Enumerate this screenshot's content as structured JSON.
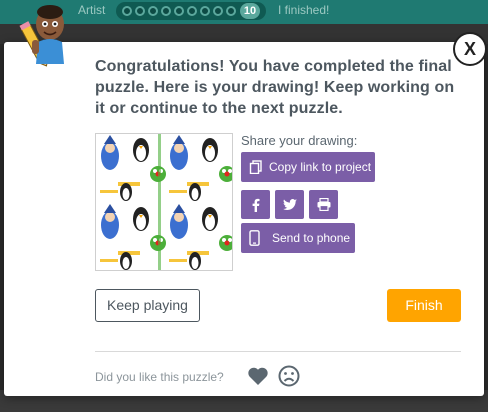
{
  "background": {
    "level_label": "Artist",
    "progress_count": "10",
    "finished_label": "I finished!"
  },
  "dialog": {
    "message": "Congratulations! You have completed the final puzzle. Here is your drawing! Keep working on it or continue to the next puzzle.",
    "close_label": "X",
    "share": {
      "label": "Share your drawing:",
      "copy_link": "Copy link to project",
      "send_to_phone": "Send to phone",
      "icons": [
        "copy-icon",
        "facebook-icon",
        "twitter-icon",
        "print-icon",
        "phone-icon"
      ]
    },
    "keep_playing": "Keep playing",
    "finish": "Finish",
    "feedback": {
      "prompt": "Did you like this puzzle?",
      "icons": [
        "heart-icon",
        "frown-icon"
      ]
    }
  },
  "colors": {
    "accent_purple": "#7b5ea7",
    "finish_orange": "#ffa400",
    "text": "#4d575f",
    "header_teal": "#1f7a72"
  }
}
